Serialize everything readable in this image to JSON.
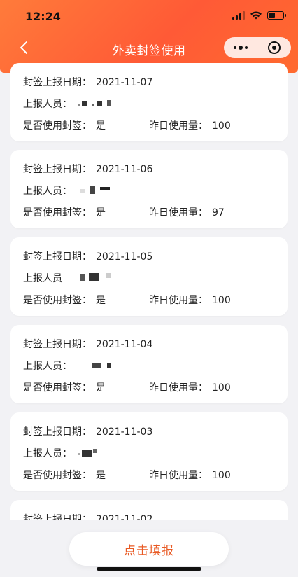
{
  "status_bar": {
    "time": "12:24"
  },
  "nav": {
    "back_icon": "chevron-left-icon",
    "title": "外卖封签使用",
    "capsule": {
      "more_icon": "more-dots-icon",
      "close_icon": "target-circle-icon"
    }
  },
  "labels": {
    "date": "封签上报日期：",
    "reporter": "上报人员：",
    "reporter_alt": "上报人员",
    "used_seal": "是否使用封签：",
    "usage": "昨日使用量："
  },
  "records": [
    {
      "date": "2021-11-07",
      "reporter_label": "上报人员：",
      "used": "是",
      "usage": "100"
    },
    {
      "date": "2021-11-06",
      "reporter_label": "上报人员：",
      "used": "是",
      "usage": "97"
    },
    {
      "date": "2021-11-05",
      "reporter_label": "上报人员",
      "used": "是",
      "usage": "100"
    },
    {
      "date": "2021-11-04",
      "reporter_label": "上报人员：",
      "used": "是",
      "usage": "100"
    },
    {
      "date": "2021-11-03",
      "reporter_label": "上报人员：",
      "used": "是",
      "usage": "100"
    },
    {
      "date": "2021-11-02"
    }
  ],
  "footer": {
    "report_button": "点击填报"
  },
  "colors": {
    "header_start": "#ff7b3a",
    "header_end": "#ff5a36",
    "button_text": "#e85a24",
    "background": "#f2f2f5"
  }
}
